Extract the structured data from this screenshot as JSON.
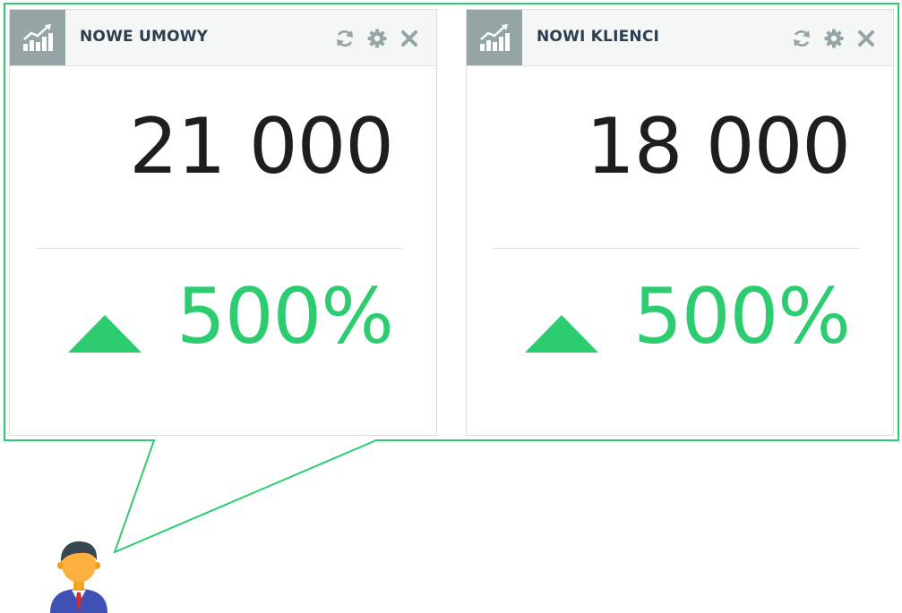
{
  "widgets": [
    {
      "title": "NOWE UMOWY",
      "value": "21 000",
      "percent": "500%",
      "trend": "up",
      "icon": "chart-icon",
      "actions": [
        "refresh-icon",
        "gear-icon",
        "close-icon"
      ]
    },
    {
      "title": "NOWI KLIENCI",
      "value": "18 000",
      "percent": "500%",
      "trend": "up",
      "icon": "chart-icon",
      "actions": [
        "refresh-icon",
        "gear-icon",
        "close-icon"
      ]
    }
  ],
  "colors": {
    "accent": "#2ecc71",
    "header_icon_bg": "#95a5a6",
    "action_icon": "#95a5a6",
    "title": "#2c3e50",
    "value": "#1e1e1e"
  }
}
